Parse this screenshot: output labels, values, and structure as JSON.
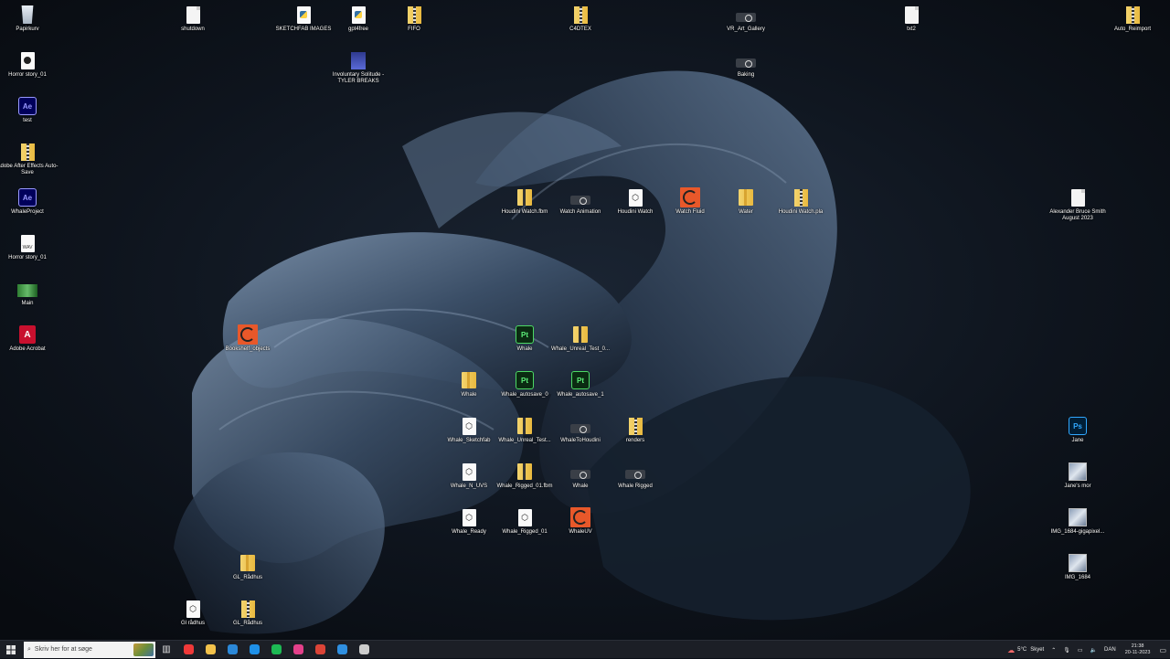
{
  "desktop_icons": [
    {
      "label": "Papirkurv",
      "icon": "recycle-bin-icon",
      "type": "bin"
    },
    {
      "label": "Horror story_01",
      "icon": "media-file-icon",
      "type": "media"
    },
    {
      "label": "test",
      "icon": "after-effects-icon",
      "type": "ae"
    },
    {
      "label": "Adobe After Effects Auto-Save",
      "icon": "folder-icon",
      "type": "zip"
    },
    {
      "label": "WhaleProject",
      "icon": "after-effects-icon",
      "type": "ae"
    },
    {
      "label": "Horror story_01",
      "icon": "audio-file-icon",
      "type": "wav"
    },
    {
      "label": "Main",
      "icon": "image-file-icon",
      "type": "green"
    },
    {
      "label": "Adobe Acrobat",
      "icon": "acrobat-icon",
      "type": "pdf"
    },
    {
      "label": "shutdown",
      "icon": "script-file-icon",
      "type": "doc"
    },
    {
      "label": "SKETCHFAB IMAGES",
      "icon": "python-file-icon",
      "type": "py"
    },
    {
      "label": "gpt4free",
      "icon": "python-file-icon",
      "type": "py"
    },
    {
      "label": "FIFO",
      "icon": "folder-icon",
      "type": "zip"
    },
    {
      "label": "C4DTEX",
      "icon": "folder-icon",
      "type": "zip"
    },
    {
      "label": "VR_Art_Gallery",
      "icon": "video-icon",
      "type": "film"
    },
    {
      "label": "txt2",
      "icon": "json-file-icon",
      "type": "doc"
    },
    {
      "label": "Auto_Reimport",
      "icon": "folder-icon",
      "type": "zip"
    },
    {
      "label": "Involuntary Solitude - TYLER BREAKS",
      "icon": "image-file-icon",
      "type": "blue"
    },
    {
      "label": "Baking",
      "icon": "video-icon",
      "type": "film"
    },
    {
      "label": "Houdini Watch.fbm",
      "icon": "folder-icon",
      "type": "folderdark"
    },
    {
      "label": "Watch Animation",
      "icon": "video-icon",
      "type": "film"
    },
    {
      "label": "Houdini Watch",
      "icon": "3d-model-icon",
      "type": "cube"
    },
    {
      "label": "Watch Fluid",
      "icon": "houdini-icon",
      "type": "houdini"
    },
    {
      "label": "Water",
      "icon": "folder-icon",
      "type": "folder"
    },
    {
      "label": "Houdini Watch.pla",
      "icon": "folder-icon",
      "type": "zip"
    },
    {
      "label": "Alexander Bruce Smith August 2023",
      "icon": "document-icon",
      "type": "doc"
    },
    {
      "label": "Bookshelf_objects",
      "icon": "houdini-icon",
      "type": "houdini"
    },
    {
      "label": "Whale",
      "icon": "painter-icon",
      "type": "pt"
    },
    {
      "label": "Whale_Unreal_Test_0...",
      "icon": "folder-icon",
      "type": "folderdark"
    },
    {
      "label": "Whale",
      "icon": "folder-icon",
      "type": "folder"
    },
    {
      "label": "Whale_autosave_0",
      "icon": "painter-icon",
      "type": "pt"
    },
    {
      "label": "Whale_autosave_1",
      "icon": "painter-icon",
      "type": "pt"
    },
    {
      "label": "Whale_Sketchfab",
      "icon": "3d-model-icon",
      "type": "cube"
    },
    {
      "label": "Whale_Unreal_Test...",
      "icon": "folder-icon",
      "type": "folderdark"
    },
    {
      "label": "WhaleToHoudini",
      "icon": "video-icon",
      "type": "film"
    },
    {
      "label": "renders",
      "icon": "folder-icon",
      "type": "zip"
    },
    {
      "label": "Jane",
      "icon": "photoshop-icon",
      "type": "ps"
    },
    {
      "label": "Whale_N_UVS",
      "icon": "3d-model-icon",
      "type": "cube"
    },
    {
      "label": "Whale_Rigged_01.fbm",
      "icon": "folder-icon",
      "type": "folderdark"
    },
    {
      "label": "Whale",
      "icon": "video-icon",
      "type": "film"
    },
    {
      "label": "Whale Rigged",
      "icon": "video-icon",
      "type": "film"
    },
    {
      "label": "Jane's mor",
      "icon": "image-file-icon",
      "type": "img"
    },
    {
      "label": "Whale_Ready",
      "icon": "3d-model-icon",
      "type": "cube"
    },
    {
      "label": "Whale_Rigged_01",
      "icon": "3d-model-icon",
      "type": "cube"
    },
    {
      "label": "WhaleUV",
      "icon": "houdini-icon",
      "type": "houdini"
    },
    {
      "label": "IMG_1684-gigapixel...",
      "icon": "image-file-icon",
      "type": "img"
    },
    {
      "label": "GL_Rådhus",
      "icon": "folder-icon",
      "type": "folder"
    },
    {
      "label": "IMG_1684",
      "icon": "image-file-icon",
      "type": "img"
    },
    {
      "label": "Gl rådhus",
      "icon": "3d-model-icon",
      "type": "cube"
    },
    {
      "label": "GL_Rådhus",
      "icon": "folder-icon",
      "type": "zip"
    }
  ],
  "taskbar": {
    "start_icon": "windows-start-icon",
    "search_placeholder": "Skriv her for at søge",
    "task_view_icon": "task-view-icon",
    "pinned_apps": [
      {
        "name": "vivaldi-icon",
        "color": "#ef3939"
      },
      {
        "name": "file-explorer-icon",
        "color": "#f3c24b"
      },
      {
        "name": "microsoft-store-icon",
        "color": "#2b88d8"
      },
      {
        "name": "mail-icon",
        "color": "#1e90e8"
      },
      {
        "name": "spotify-icon",
        "color": "#1db954"
      },
      {
        "name": "app-icon",
        "color": "#e3408a"
      },
      {
        "name": "chrome-icon",
        "color": "#db4437"
      },
      {
        "name": "vscode-icon",
        "color": "#2f8fe0"
      },
      {
        "name": "terminal-icon",
        "color": "#cccccc"
      }
    ],
    "weather_temp": "5°C",
    "weather_text": "Skyet",
    "language": "DAN",
    "time": "21:38",
    "date": "20-11-2023"
  }
}
